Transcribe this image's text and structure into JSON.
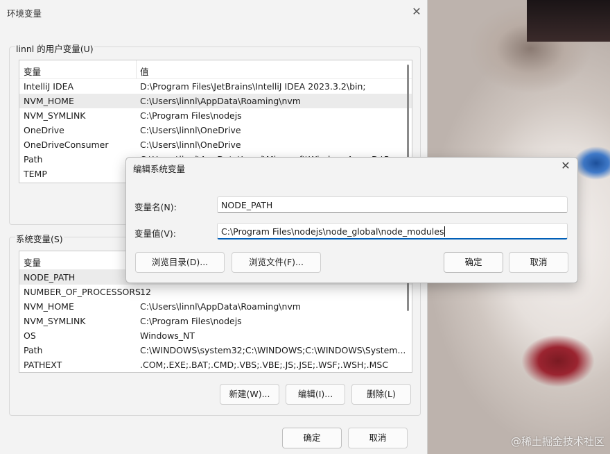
{
  "env_window": {
    "title": "环境变量",
    "user_group_label": "linnl 的用户变量(U)",
    "system_group_label": "系统变量(S)",
    "columns": [
      "变量",
      "值"
    ],
    "user_vars": [
      {
        "name": "IntelliJ IDEA",
        "value": "D:\\Program Files\\JetBrains\\IntelliJ IDEA 2023.3.2\\bin;"
      },
      {
        "name": "NVM_HOME",
        "value": "C:\\Users\\linnl\\AppData\\Roaming\\nvm"
      },
      {
        "name": "NVM_SYMLINK",
        "value": "C:\\Program Files\\nodejs"
      },
      {
        "name": "OneDrive",
        "value": "C:\\Users\\linnl\\OneDrive"
      },
      {
        "name": "OneDriveConsumer",
        "value": "C:\\Users\\linnl\\OneDrive"
      },
      {
        "name": "Path",
        "value": "C:\\Users\\linnl\\AppData\\Local\\Microsoft\\WindowsApps;D:\\P..."
      },
      {
        "name": "TEMP",
        "value": ""
      }
    ],
    "system_vars": [
      {
        "name": "NODE_PATH",
        "value": ""
      },
      {
        "name": "NUMBER_OF_PROCESSORS",
        "value": "12"
      },
      {
        "name": "NVM_HOME",
        "value": "C:\\Users\\linnl\\AppData\\Roaming\\nvm"
      },
      {
        "name": "NVM_SYMLINK",
        "value": "C:\\Program Files\\nodejs"
      },
      {
        "name": "OS",
        "value": "Windows_NT"
      },
      {
        "name": "Path",
        "value": "C:\\WINDOWS\\system32;C:\\WINDOWS;C:\\WINDOWS\\System..."
      },
      {
        "name": "PATHEXT",
        "value": ".COM;.EXE;.BAT;.CMD;.VBS;.VBE;.JS;.JSE;.WSF;.WSH;.MSC"
      }
    ],
    "system_buttons": {
      "new": "新建(W)...",
      "edit": "编辑(I)...",
      "delete": "删除(L)"
    },
    "ok": "确定",
    "cancel": "取消"
  },
  "edit_dialog": {
    "title": "编辑系统变量",
    "name_label": "变量名(N):",
    "value_label": "变量值(V):",
    "name_value": "NODE_PATH",
    "value_value": "C:\\Program Files\\nodejs\\node_global\\node_modules",
    "browse_dir": "浏览目录(D)...",
    "browse_file": "浏览文件(F)...",
    "ok": "确定",
    "cancel": "取消"
  },
  "watermark": "@稀土掘金技术社区",
  "icons": {
    "close": "close-icon"
  }
}
